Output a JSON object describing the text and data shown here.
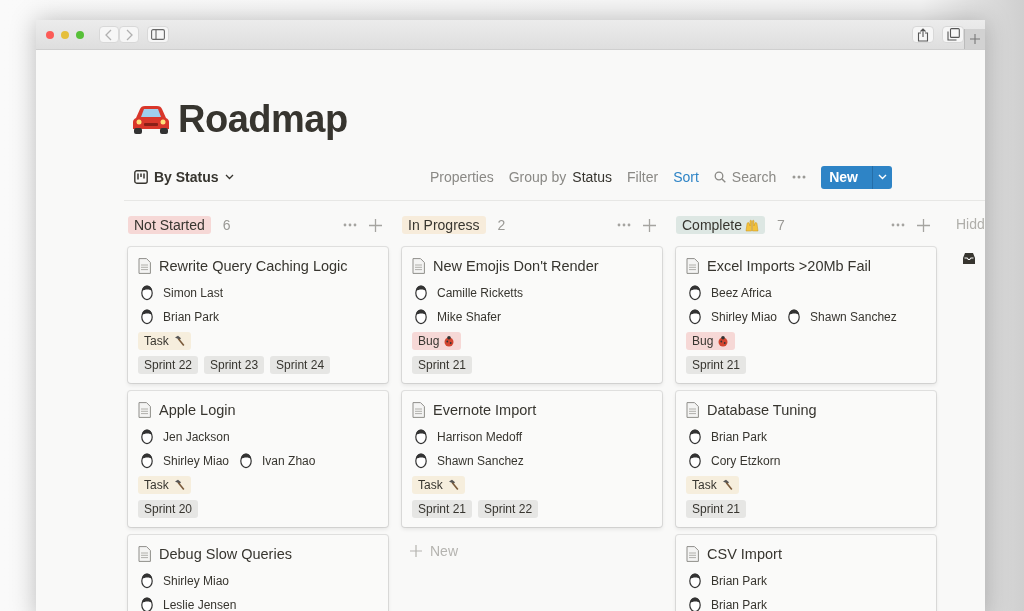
{
  "page": {
    "title": "Roadmap"
  },
  "view": {
    "label": "By Status"
  },
  "toolbar": [
    {
      "kind": "plain",
      "label": "Properties"
    },
    {
      "kind": "group",
      "label": "Group by",
      "value": "Status"
    },
    {
      "kind": "plain",
      "label": "Filter"
    },
    {
      "kind": "active",
      "label": "Sort"
    },
    {
      "kind": "search",
      "label": "Search"
    }
  ],
  "new_button": {
    "label": "New"
  },
  "columns": [
    {
      "name": "Not Started",
      "color": "#f6d8d6",
      "kind": "plain",
      "count": "6",
      "cards": [
        {
          "title": "Rewrite Query Caching Logic",
          "people": [
            [
              "Simon Last"
            ],
            [
              "Brian Park"
            ]
          ],
          "tags": [
            {
              "kind": "task",
              "label": "Task"
            }
          ],
          "sprints": [
            "Sprint 22",
            "Sprint 23",
            "Sprint 24"
          ]
        },
        {
          "title": "Apple Login",
          "people": [
            [
              "Jen Jackson"
            ],
            [
              "Shirley Miao",
              "Ivan Zhao"
            ]
          ],
          "tags": [
            {
              "kind": "task",
              "label": "Task"
            }
          ],
          "sprints": [
            "Sprint 20"
          ]
        },
        {
          "title": "Debug Slow Queries",
          "people": [
            [
              "Shirley Miao"
            ],
            [
              "Leslie Jensen"
            ]
          ]
        }
      ]
    },
    {
      "name": "In Progress",
      "color": "#f7ecdb",
      "kind": "plain",
      "count": "2",
      "add_label": "New",
      "cards": [
        {
          "title": "New Emojis Don't Render",
          "people": [
            [
              "Camille Ricketts"
            ],
            [
              "Mike Shafer"
            ]
          ],
          "tags": [
            {
              "kind": "bug",
              "label": "Bug"
            }
          ],
          "sprints": [
            "Sprint 21"
          ]
        },
        {
          "title": "Evernote Import",
          "people": [
            [
              "Harrison Medoff"
            ],
            [
              "Shawn Sanchez"
            ]
          ],
          "tags": [
            {
              "kind": "task",
              "label": "Task"
            }
          ],
          "sprints": [
            "Sprint 21",
            "Sprint 22"
          ]
        }
      ]
    },
    {
      "name": "Complete",
      "color": "#dde7e3",
      "kind": "celebrate",
      "count": "7",
      "cards": [
        {
          "title": "Excel Imports >20Mb Fail",
          "people": [
            [
              "Beez Africa"
            ],
            [
              "Shirley Miao",
              "Shawn Sanchez"
            ]
          ],
          "tags": [
            {
              "kind": "bug",
              "label": "Bug"
            }
          ],
          "sprints": [
            "Sprint 21"
          ]
        },
        {
          "title": "Database Tuning",
          "people": [
            [
              "Brian Park"
            ],
            [
              "Cory Etzkorn"
            ]
          ],
          "tags": [
            {
              "kind": "task",
              "label": "Task"
            }
          ],
          "sprints": [
            "Sprint 21"
          ]
        },
        {
          "title": "CSV Import",
          "people": [
            [
              "Brian Park"
            ],
            [
              "Brian Park"
            ]
          ]
        }
      ]
    }
  ],
  "hidden_column": {
    "label": "Hidd"
  }
}
